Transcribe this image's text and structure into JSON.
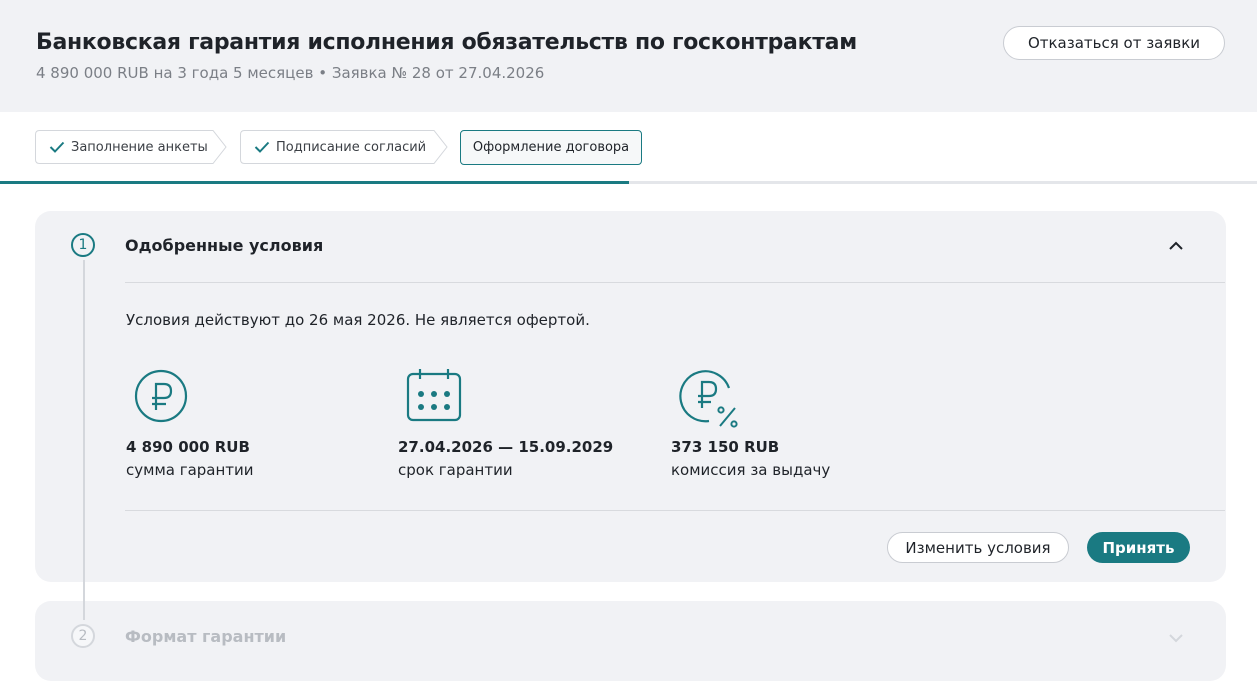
{
  "header": {
    "title": "Банковская гарантия исполнения обязательств по госконтрактам",
    "subtitle": "4 890 000 RUB на 3 года 5 месяцев • Заявка № 28 от 27.04.2026",
    "decline_label": "Отказаться от заявки"
  },
  "steps": [
    {
      "label": "Заполнение анкеты",
      "status": "done"
    },
    {
      "label": "Подписание согласий",
      "status": "done"
    },
    {
      "label": "Оформление договора",
      "status": "active"
    }
  ],
  "progress_percent": 50,
  "sections": [
    {
      "number": "1",
      "title": "Одобренные условия",
      "expanded": true,
      "validity_note": "Условия действуют до 26 мая 2026. Не является офертой.",
      "terms": [
        {
          "icon": "ruble-icon",
          "value": "4 890 000 RUB",
          "label": "сумма гарантии"
        },
        {
          "icon": "calendar-icon",
          "value": "27.04.2026 — 15.09.2029",
          "label": "срок гарантии"
        },
        {
          "icon": "ruble-percent-icon",
          "value": "373 150 RUB",
          "label": "комиссия за выдачу"
        }
      ],
      "change_label": "Изменить условия",
      "accept_label": "Принять"
    },
    {
      "number": "2",
      "title": "Формат гарантии",
      "expanded": false
    }
  ],
  "colors": {
    "accent": "#1a7a82",
    "header_bg": "#f1f2f5",
    "muted_text": "#7b7f86",
    "disabled_text": "#b8bcc2"
  }
}
